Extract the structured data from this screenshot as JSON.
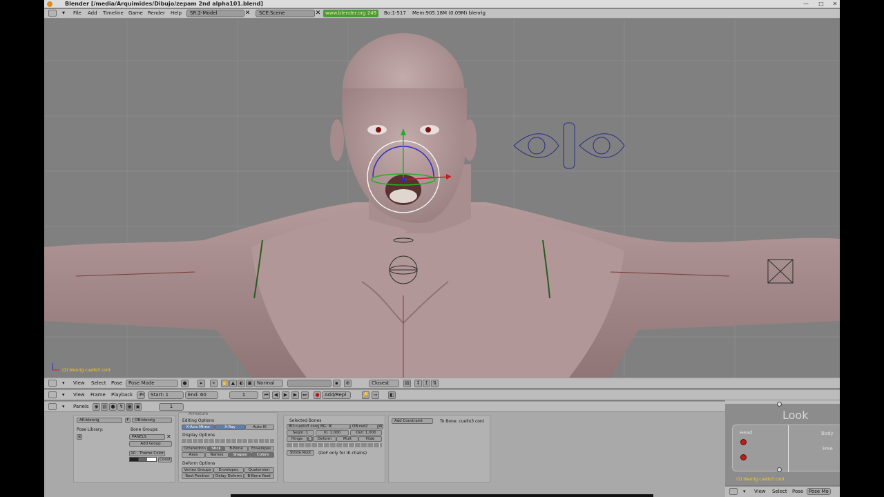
{
  "title": {
    "text": "Blender [/media/Arquimides/Dibujo/zepam 2nd alpha101.blend]"
  },
  "info_header": {
    "menus": [
      "File",
      "Add",
      "Timeline",
      "Game",
      "Render",
      "Help"
    ],
    "screen_field": "SR:2-Model",
    "scene_field": "SCE:Scene",
    "url": "www.blender.org 249",
    "stats": "Bo:1-517",
    "memory": "Mem:905.18M (0.09M) blenrig"
  },
  "viewport": {
    "status_text": "(1) blenrig cuello3 cont"
  },
  "view3d_header": {
    "menus": [
      "View",
      "Select",
      "Pose"
    ],
    "mode": "Pose Mode",
    "orientation": "Normal",
    "snap_mode": "Closest"
  },
  "timeline_header": {
    "menus": [
      "View",
      "Frame",
      "Playback"
    ],
    "pr_label": "Pr",
    "start": "Start: 1",
    "end": "End: 60",
    "current_frame": "1",
    "keying_mode": "Add/Repl"
  },
  "buttons_header": {
    "label": "Panels",
    "frame": "1"
  },
  "armature_panel": {
    "link_ar": "AR:blenrig",
    "link_ob": "OB:blenrig",
    "f_label": "F",
    "pose_library_label": "Pose Library:",
    "bone_groups_label": "Bone Groups:",
    "group_name": "PANELS",
    "add_group": "Add Group",
    "theme_color": "10 - Theme Color",
    "const_label": "Const"
  },
  "editing_options": {
    "header": "Editing Options",
    "x_axis_mirror": "X-Axis Mirror",
    "x_ray": "X-Ray",
    "auto_ik": "Auto IK",
    "display_options": "Display Options",
    "octahedron": "Octahedron",
    "stick": "Stick",
    "bbone": "B-Bone",
    "envelopes": "Envelopes",
    "axes": "Axes",
    "names": "Names",
    "shapes": "Shapes",
    "colors": "Colors",
    "deform_options": "Deform Options",
    "vertex_groups": "Vertex Groups",
    "envelopes2": "Envelopes",
    "quaternion": "Quaternion",
    "rest_position": "Rest Position",
    "delay_deform": "Delay Deform",
    "bbone_rest": "B-Bone Rest",
    "panel_tab": "Armature"
  },
  "selected_bones": {
    "header": "Selected Bones",
    "bone_name": "BO:cuello3 cont",
    "ik_field": "BG: IK",
    "ob_field": "OB:red2",
    "segm": "Segm: 1",
    "in_val": "In: 1.000",
    "out_val": "Out: 1.000",
    "hinge": "Hinge",
    "s_label": "S",
    "deform": "Deform",
    "mult": "Mult",
    "hide": "Hide",
    "stride_root": "Stride Root",
    "ik_note": "(DoF only for IK chains)"
  },
  "constraints": {
    "add_constraint": "Add Constraint",
    "to_bone": "To Bone: cuello3 cont"
  },
  "look_panel": {
    "title": "Look",
    "head": "Head",
    "body": "Body",
    "free": "Free",
    "status": "(1) blenrig cuello3 cont"
  },
  "bottom_header": {
    "menus": [
      "View",
      "Select",
      "Pose"
    ],
    "mode": "Pose Mo"
  },
  "colors": {
    "viewport_bg": "#808080",
    "skin": "#b89e9f",
    "accent_url": "#4a9a3a"
  }
}
